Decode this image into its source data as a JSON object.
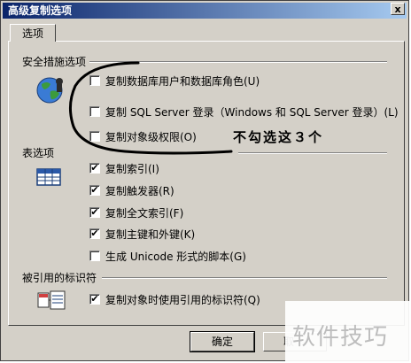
{
  "window": {
    "title": "高级复制选项",
    "close_glyph": "x"
  },
  "tab": {
    "label": "选项"
  },
  "security": {
    "label": "安全措施选项",
    "options": [
      {
        "label": "复制数据库用户和数据库角色(U)",
        "checked": false
      },
      {
        "label": "复制 SQL Server 登录（Windows 和 SQL Server 登录）(L)",
        "checked": false
      },
      {
        "label": "复制对象级权限(O)",
        "checked": false
      }
    ]
  },
  "table_options": {
    "label": "表选项",
    "options": [
      {
        "label": "复制索引(I)",
        "checked": true
      },
      {
        "label": "复制触发器(R)",
        "checked": true
      },
      {
        "label": "复制全文索引(F)",
        "checked": true
      },
      {
        "label": "复制主键和外键(K)",
        "checked": true
      },
      {
        "label": "生成 Unicode 形式的脚本(G)",
        "checked": false
      }
    ]
  },
  "referenced": {
    "label": "被引用的标识符",
    "options": [
      {
        "label": "复制对象时使用引用的标识符(Q)",
        "checked": true
      }
    ]
  },
  "buttons": {
    "ok": "确定",
    "cancel": "取"
  },
  "annotation": "不勾选这３个",
  "watermark": "软件技巧",
  "check_glyph": "✔"
}
